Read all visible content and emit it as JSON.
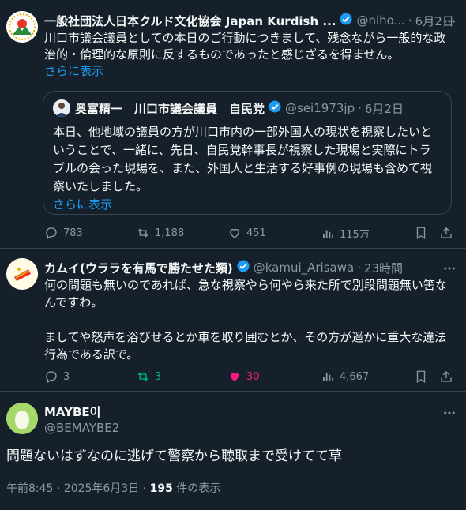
{
  "post1": {
    "name": "一般社団法人日本クルド文化協会 Japan Kurdish ...",
    "handle": "@niho...",
    "date": "6月2日",
    "sep": "·",
    "text_line1": "川口市議会議員としての本日のご行動につきまして、残念ながら一般的な政",
    "text_line2": "治的・倫理的な原則に反するものであったと感じざるを得ません。",
    "show_more": "さらに表示",
    "quote": {
      "name": "奥富精一　川口市議会議員　自民党",
      "handle": "@sei1973jp",
      "date": "6月2日",
      "line1": "本日、他地域の議員の方が川口市内の一部外国人の現状を視察したいと",
      "line2": "いうことで、一緒に、先日、自民党幹事長が視察した現場と実際にトラ",
      "line3": "ブルの会った現場を、また、外国人と生活する好事例の現場も含めて視",
      "line4": "察いたしました。",
      "show_more": "さらに表示"
    },
    "replies": "783",
    "reposts": "1,188",
    "likes": "451",
    "views": "115万"
  },
  "post2": {
    "name": "カムイ(ウララを有馬で勝たせた類)",
    "handle": "@kamui_Arisawa",
    "date": "23時間",
    "sep": "·",
    "text_line1": "何の問題も無いのであれば、急な視察やら何やら来た所で別段問題無い筈な",
    "text_line2": "んですわ。",
    "text_line3": "ましてや怒声を浴びせるとか車を取り囲むとか、その方が遥かに重大な違法",
    "text_line4": "行為である訳で。",
    "replies": "3",
    "reposts": "3",
    "likes": "30",
    "views": "4,667"
  },
  "post3": {
    "name": "MAYBE이",
    "handle": "@BEMAYBE2",
    "text": "問題ないはずなのに逃げて警察から聴取まで受けてて草",
    "time": "午前8:45 · 2025年6月3日 · ",
    "view_count": "195",
    "view_label": " 件の表示"
  },
  "colors": {
    "background": "#15202b",
    "accent": "#1d9bf0",
    "repost_active": "#00ba7c",
    "like_active": "#f91880",
    "muted": "#8b98a5"
  },
  "icons": [
    "reply-icon",
    "repost-icon",
    "like-icon",
    "views-icon",
    "bookmark-icon",
    "share-icon",
    "more-icon",
    "verified-icon"
  ]
}
